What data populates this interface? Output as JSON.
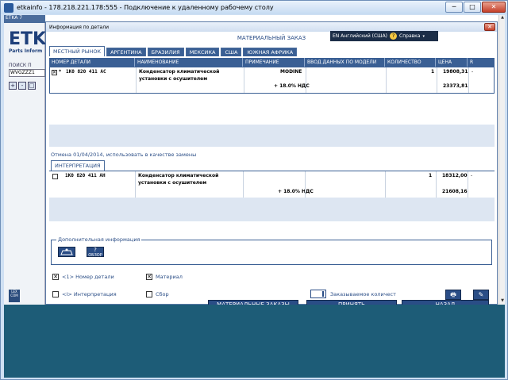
{
  "window": {
    "title": "etkainfo - 178.218.221.178:555 - Подключение к удаленному рабочему столу",
    "min": "─",
    "max": "□",
    "close": "✕"
  },
  "background_app": {
    "title": "ETKA 7",
    "logo": "ETK",
    "logo_sub": "Parts Inform",
    "search_label": "ПОИСК П",
    "search_value": "WVGZZZ1",
    "lex_logo": "LEX COM",
    "zoom_tools": [
      "+",
      "-",
      "□"
    ]
  },
  "lang_bar": {
    "language": "EN Английский (США)",
    "help": "Справка",
    "help_mark": "?",
    "arrow": "▾"
  },
  "dialog": {
    "title": "Информация по детали",
    "close": "✕",
    "heading": "МАТЕРИАЛЬНЫЙ ЗАКАЗ",
    "tabs": [
      "МЕСТНЫЙ РЫНОК",
      "АРГЕНТИНА",
      "БРАЗИЛИЯ",
      "МЕКСИКА",
      "США",
      "ЮЖНАЯ АФРИКА"
    ],
    "columns": [
      "НОМЕР ДЕТАЛИ",
      "НАИМЕНОВАНИЕ",
      "ПРИМЕЧАНИЕ",
      "ВВОД ДАННЫХ ПО МОДЕЛИ",
      "КОЛИЧЕСТВО",
      "ЦЕНА",
      "R"
    ],
    "main_row": {
      "checked": "✕",
      "marker": "*",
      "part_no": "1K0 820 411 AC",
      "name_line1": "Конденсатор климатической",
      "name_line2": "установки с осушителем",
      "note": "MODINE",
      "vat": "+ 18.0% НДС",
      "qty": "1",
      "price": "19808,31",
      "price_vat": "23373,81",
      "r": "-"
    },
    "note_line": "Отмена 01/04/2014, использовать в качестве замены",
    "interp_tab": "ИНТЕРПРЕТАЦИЯ",
    "interp_row": {
      "part_no": "1K0 820 411 AH",
      "name_line1": "Конденсатор климатической",
      "name_line2": "установки с осушителем",
      "vat": "+ 18.0% НДС",
      "qty": "1",
      "price": "18312,00",
      "price_vat": "21608,16",
      "r": "-"
    },
    "addinfo_label": "Дополнительная информация",
    "addinfo_btn2": "ОБЗОР",
    "options": {
      "part_no": "<1> Номер детали",
      "material": "Материал",
      "interpretation": "<I> Интерпретация",
      "assembly": "Сбор",
      "ordered_qty": "Заказываемое количест"
    },
    "option_marks": {
      "part_no": "✕",
      "material": "✕"
    },
    "tools": {
      "print": "🖶",
      "edit": "✎"
    },
    "buttons": {
      "material_orders": "МАТЕРИАЛЬНЫЕ ЗАКАЗЫ",
      "accept": "ПРИНЯТЬ",
      "back": "НАЗАД"
    }
  },
  "scrollbar": {
    "up": "▲",
    "down": "▼"
  }
}
